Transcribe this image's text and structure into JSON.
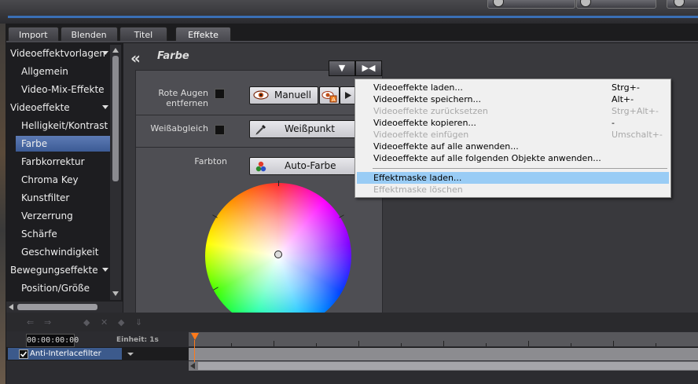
{
  "tabs": [
    "Import",
    "Blenden",
    "Titel",
    "Effekte"
  ],
  "sidebar": {
    "items": [
      {
        "label": "Videoeffektvorlagen",
        "type": "group"
      },
      {
        "label": "Allgemein",
        "type": "item"
      },
      {
        "label": "Video-Mix-Effekte",
        "type": "item"
      },
      {
        "label": "Videoeffekte",
        "type": "group"
      },
      {
        "label": "Helligkeit/Kontrast",
        "type": "item"
      },
      {
        "label": "Farbe",
        "type": "item",
        "selected": true
      },
      {
        "label": "Farbkorrektur",
        "type": "item"
      },
      {
        "label": "Chroma Key",
        "type": "item"
      },
      {
        "label": "Kunstfilter",
        "type": "item"
      },
      {
        "label": "Verzerrung",
        "type": "item"
      },
      {
        "label": "Schärfe",
        "type": "item"
      },
      {
        "label": "Geschwindigkeit",
        "type": "item"
      },
      {
        "label": "Bewegungseffekte",
        "type": "group"
      },
      {
        "label": "Position/Größe",
        "type": "item"
      }
    ]
  },
  "panel": {
    "back_glyph": "«",
    "title": "Farbe",
    "rote_augen_label_1": "Rote Augen",
    "rote_augen_label_2": "entfernen",
    "manuell_label": "Manuell",
    "weissabgleich_label": "Weißabgleich",
    "weisspunkt_label": "Weißpunkt",
    "farbton_label": "Farbton",
    "autofarbe_label": "Auto-Farbe"
  },
  "menu_buttons": {
    "dropdown_glyph": "▼",
    "collapse_glyph": "▶◀"
  },
  "context_menu": {
    "items": [
      {
        "label": "Videoeffekte laden...",
        "shortcut": "Strg+-",
        "disabled": false
      },
      {
        "label": "Videoeffekte speichern...",
        "shortcut": "Alt+-",
        "disabled": false
      },
      {
        "label": "Videoeffekte zurücksetzen",
        "shortcut": "Strg+Alt+-",
        "disabled": true
      },
      {
        "label": "Videoeffekte kopieren...",
        "shortcut": "-",
        "disabled": false
      },
      {
        "label": "Videoeffekte einfügen",
        "shortcut": "Umschalt+-",
        "disabled": true
      },
      {
        "label": "Videoeffekte auf alle anwenden...",
        "shortcut": "",
        "disabled": false
      },
      {
        "label": "Videoeffekte auf alle folgenden Objekte anwenden...",
        "shortcut": "",
        "disabled": false
      },
      {
        "label": "Effektmaske laden...",
        "shortcut": "",
        "disabled": false,
        "highlighted": true
      },
      {
        "label": "Effektmaske löschen",
        "shortcut": "",
        "disabled": true
      }
    ]
  },
  "timeline": {
    "timecode": "00:00:00:00",
    "einheit_label": "Einheit:",
    "einheit_value": "1s",
    "track_label": "Anti-Interlacefilter",
    "playhead_color": "#ff7a1a"
  },
  "colors": {
    "accent_selected": "#4a6aa8",
    "menu_highlight": "#99ccf5",
    "top_blue_line": "#3a6fb5"
  }
}
